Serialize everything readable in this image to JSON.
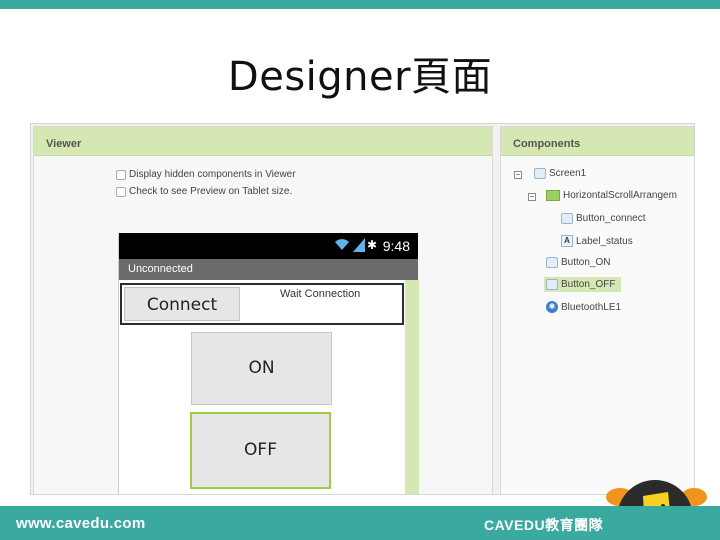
{
  "slide": {
    "title": "Designer頁面"
  },
  "viewer": {
    "header": "Viewer",
    "display_hidden_label": "Display hidden components in Viewer",
    "preview_tablet_label": "Check to see Preview on Tablet size."
  },
  "phone": {
    "status_time": "9:48",
    "app_title": "Unconnected",
    "connect_button": "Connect",
    "status_label": "Wait Connection",
    "on_button": "ON",
    "off_button": "OFF"
  },
  "components": {
    "header": "Components",
    "items": [
      {
        "label": "Screen1",
        "icon": "screen-icon"
      },
      {
        "label": "HorizontalScrollArrangem",
        "icon": "arrangement-icon"
      },
      {
        "label": "Button_connect",
        "icon": "button-icon"
      },
      {
        "label": "Label_status",
        "icon": "label-icon"
      },
      {
        "label": "Button_ON",
        "icon": "button-icon"
      },
      {
        "label": "Button_OFF",
        "icon": "button-icon"
      },
      {
        "label": "BluetoothLE1",
        "icon": "bluetooth-icon"
      }
    ]
  },
  "footer": {
    "url": "www.cavedu.com",
    "brand": "CAVEDU教育團隊"
  },
  "colors": {
    "accent_teal": "#3aa99f",
    "panel_green": "#d5e8b3",
    "selection_border": "#9fcc45"
  }
}
